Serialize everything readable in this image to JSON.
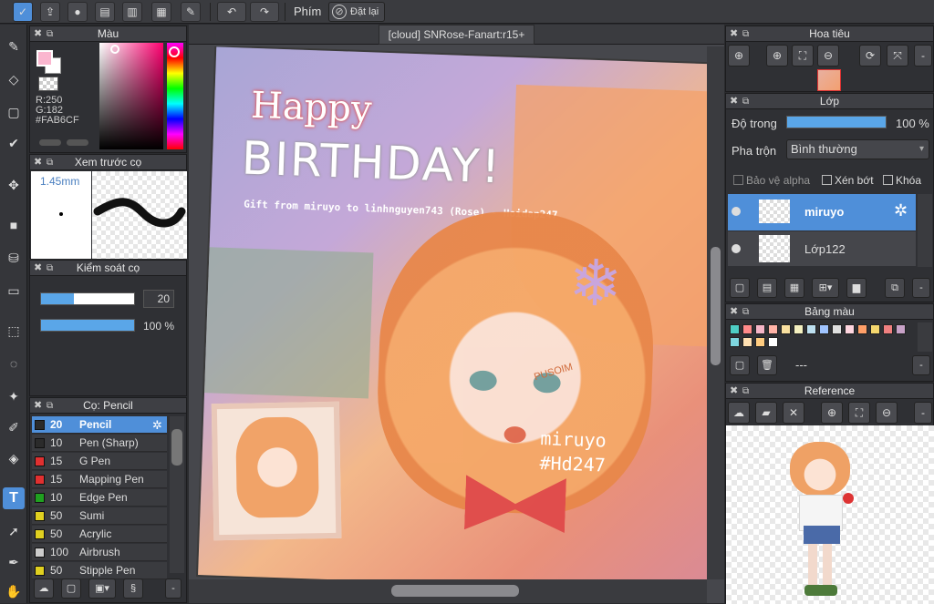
{
  "toolbar": {
    "phim_label": "Phím",
    "reset_label": "Đặt lại"
  },
  "canvas_tab": {
    "title": "[cloud] SNRose-Fanart:r15+"
  },
  "color_panel": {
    "title": "Màu",
    "r": "R:250",
    "g": "G:182",
    "hex": "#FAB6CF",
    "main_color": "#FAB6CF"
  },
  "preview_panel": {
    "title": "Xem trước cọ",
    "size": "1.45mm"
  },
  "brush_control": {
    "title": "Kiểm soát cọ",
    "size_value": "20",
    "opacity_value": "100 %",
    "size_fraction": 0.35,
    "opacity_fraction": 1.0
  },
  "brush_panel": {
    "title": "Cọ: Pencil",
    "items": [
      {
        "size": "20",
        "name": "Pencil",
        "color": "#2b2b2b"
      },
      {
        "size": "10",
        "name": "Pen (Sharp)",
        "color": "#2b2b2b"
      },
      {
        "size": "15",
        "name": "G Pen",
        "color": "#e03030"
      },
      {
        "size": "15",
        "name": "Mapping Pen",
        "color": "#e03030"
      },
      {
        "size": "10",
        "name": "Edge Pen",
        "color": "#20a020"
      },
      {
        "size": "50",
        "name": "Sumi",
        "color": "#e0d020"
      },
      {
        "size": "50",
        "name": "Acrylic",
        "color": "#e0d020"
      },
      {
        "size": "100",
        "name": "Airbrush",
        "color": "#cccccc"
      },
      {
        "size": "50",
        "name": "Stipple Pen",
        "color": "#e0d020"
      }
    ]
  },
  "navigator": {
    "title": "Hoa tiêu"
  },
  "layers": {
    "title": "Lớp",
    "opacity_label": "Độ trong",
    "opacity_value": "100 %",
    "opacity_fraction": 1.0,
    "blend_label": "Pha trộn",
    "blend_value": "Bình thường",
    "protect_alpha": "Bảo vệ alpha",
    "clipping": "Xén bớt",
    "lock": "Khóa",
    "items": [
      {
        "name": "miruyo"
      },
      {
        "name": "Lớp122"
      }
    ]
  },
  "palette": {
    "title": "Bảng màu",
    "name": "---",
    "colors": [
      "#4ecdc4",
      "#ff8a8a",
      "#f6b6c8",
      "#ffb3a7",
      "#f9e0a0",
      "#f4f0c0",
      "#bde0f0",
      "#a0c4ff",
      "#e0e0e0",
      "#ffd6e0",
      "#ff9f68",
      "#f5d76e",
      "#f08080",
      "#c8a2c8",
      "#7ed6df",
      "#ffe0b2",
      "#ffcc80",
      "#fff"
    ]
  },
  "reference": {
    "title": "Reference"
  },
  "artwork": {
    "line1": "Happy",
    "line2": "BIRTHDAY!",
    "gift": "Gift from miruyo to linhnguyen743 (Rose) - Hoidap247",
    "signature": "miruyo",
    "hashtag": "#Hd247",
    "watermark": "PUSOIM"
  }
}
